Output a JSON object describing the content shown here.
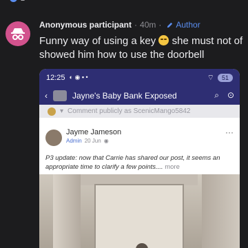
{
  "top": {
    "count": "2"
  },
  "comment": {
    "author": "Anonymous participant",
    "separator": "·",
    "time": "40m",
    "separator2": "·",
    "author_tag": "Author",
    "text_before_emoji": "Funny way of using a key ",
    "text_after_emoji": " she must not of showed him how to use the doorbell"
  },
  "screenshot": {
    "status_time": "12:25",
    "status_icons": "◐ ◉ ▪ •",
    "battery": "51",
    "group_title": "Jayne's Baby Bank Exposed",
    "comment_placeholder": "Comment publicly as ScenicMango5842",
    "post": {
      "author": "Jayme Jameson",
      "role": "Admin",
      "date": "20 Jun",
      "text": "P3 update: now that Carrie has shared our post, it seems an appropriate time to clarify a few points.... ",
      "more": "more"
    }
  },
  "colors": {
    "background": "#1c1c1e",
    "avatar": "#d2528d",
    "author_tag": "#5b8ef0",
    "app_bar": "#2e2e73"
  }
}
